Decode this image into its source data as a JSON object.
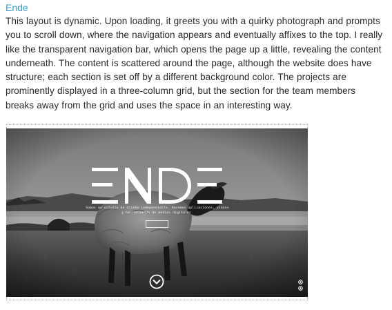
{
  "article": {
    "title": "Ende",
    "body": "This layout is dynamic. Upon loading, it greets you with a quirky photograph and prompts you to scroll down, where the navigation appears and eventually affixes to the top. I really like the transparent navigation bar, which opens the page up a little, revealing the content underneath. The content is scattered around the page, although the website does have structure; each section is set off by a different background color. The projects are prominently displayed in a three-column grid, but the section for the team members breaks away from the grid and uses the space in an interesting way."
  },
  "screenshot": {
    "logo_text": "ENDE",
    "tagline_line1": "Somos un estudio de diseño independiente. Hacemos aplicaciones, videos",
    "tagline_line2": "y herramientas de medios digitales.",
    "scroll_icon": "chevron-down-circle-icon",
    "side_icons": [
      "dot-icon",
      "dot-icon"
    ]
  },
  "colors": {
    "link": "#3a9fd6",
    "body_text": "#2a2a2a",
    "frame_border": "#7fb8d8"
  }
}
